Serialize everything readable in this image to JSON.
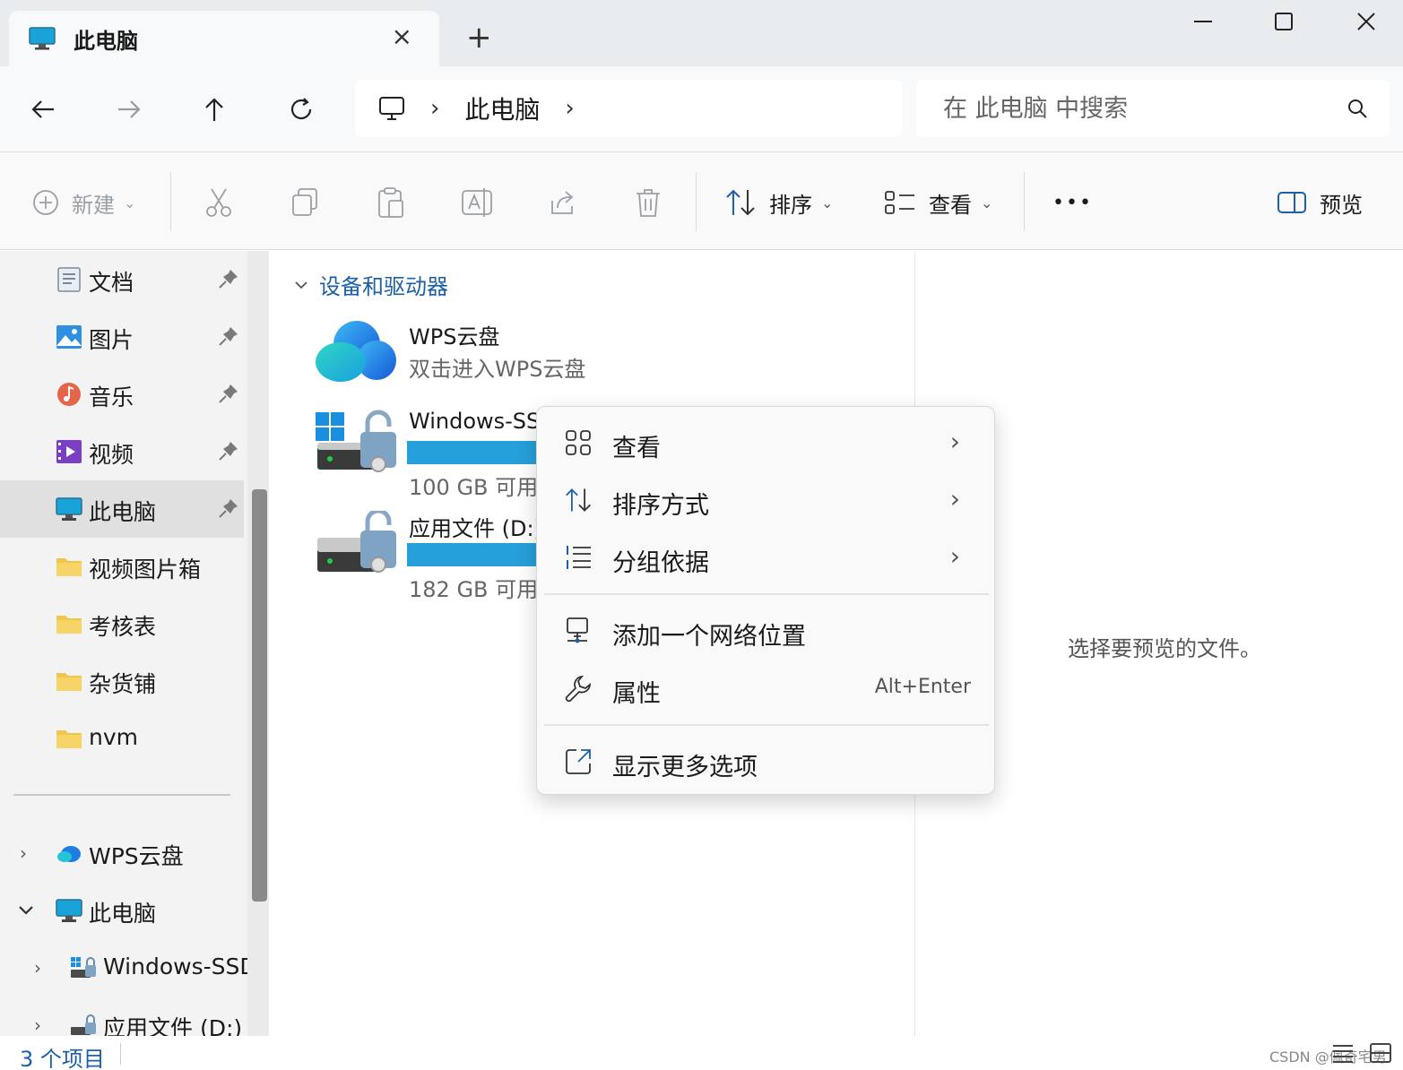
{
  "window": {
    "tab_title": "此电脑",
    "tab_close": "×",
    "new_tab": "+"
  },
  "address": {
    "crumb": "此电脑",
    "search_placeholder": "在 此电脑 中搜索"
  },
  "toolbar": {
    "new_label": "新建",
    "sort_label": "排序",
    "view_label": "查看",
    "more_label": "•••",
    "preview_label": "预览"
  },
  "sidebar": {
    "quick_items": [
      {
        "label": "文档",
        "icon": "document-icon"
      },
      {
        "label": "图片",
        "icon": "pictures-icon"
      },
      {
        "label": "音乐",
        "icon": "music-icon"
      },
      {
        "label": "视频",
        "icon": "video-icon"
      },
      {
        "label": "此电脑",
        "icon": "computer-icon",
        "selected": true
      },
      {
        "label": "视频图片箱",
        "icon": "folder-icon"
      },
      {
        "label": "考核表",
        "icon": "folder-icon"
      },
      {
        "label": "杂货铺",
        "icon": "folder-icon"
      },
      {
        "label": "nvm",
        "icon": "folder-icon"
      }
    ],
    "tree_items": [
      {
        "label": "WPS云盘",
        "icon": "cloud-icon",
        "expander": ">"
      },
      {
        "label": "此电脑",
        "icon": "computer-icon",
        "expander": "v"
      },
      {
        "label": "Windows-SSD",
        "icon": "drive-icon",
        "expander": ">"
      },
      {
        "label": "应用文件 (D:)",
        "icon": "drive-icon",
        "expander": ">"
      }
    ]
  },
  "main": {
    "group_title": "设备和驱动器",
    "drives": [
      {
        "name": "WPS云盘",
        "subtitle": "双击进入WPS云盘",
        "icon": "cloud-icon"
      },
      {
        "name": "Windows-SS",
        "free": "100 GB 可用",
        "used_fraction": 0.78,
        "icon": "locked-drive-icon"
      },
      {
        "name": "应用文件 (D:)",
        "free": "182 GB 可用",
        "used_fraction": 0.57,
        "icon": "locked-drive-icon"
      }
    ]
  },
  "preview": {
    "text": "选择要预览的文件。"
  },
  "status": {
    "count": "3 个项目",
    "watermark": "CSDN @佩奇宅男"
  },
  "context_menu": {
    "items": [
      {
        "label": "查看",
        "icon": "grid-view-icon",
        "submenu": "›"
      },
      {
        "label": "排序方式",
        "icon": "sort-icon",
        "submenu": "›"
      },
      {
        "label": "分组依据",
        "icon": "group-list-icon",
        "submenu": "›"
      },
      {
        "label": "添加一个网络位置",
        "icon": "network-location-icon"
      },
      {
        "label": "属性",
        "icon": "wrench-icon",
        "shortcut": "Alt+Enter"
      },
      {
        "label": "显示更多选项",
        "icon": "open-external-icon"
      }
    ]
  },
  "colors": {
    "accent": "#26a0da",
    "link": "#1d5fa8",
    "selection": "#e0e0e0"
  }
}
